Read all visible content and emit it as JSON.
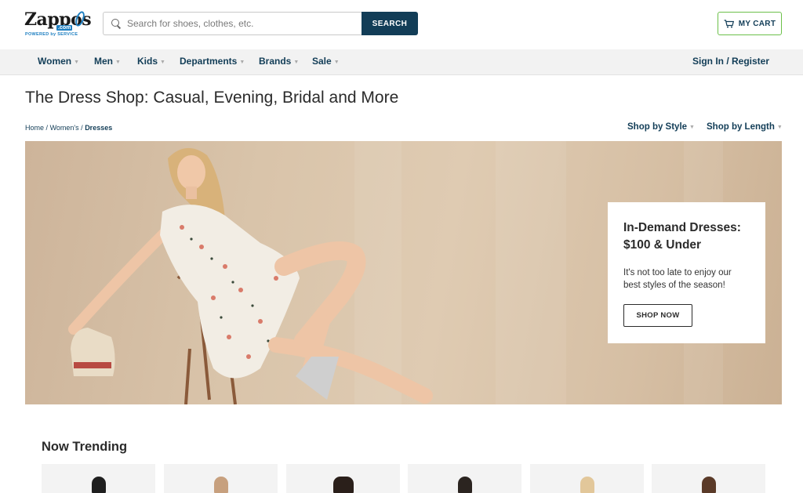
{
  "header": {
    "logo": {
      "name": "Zappos",
      "com": ".com",
      "tagline": "POWERED by SERVICE"
    },
    "search": {
      "placeholder": "Search for shoes, clothes, etc.",
      "button_label": "SEARCH"
    },
    "cart_label": "MY CART"
  },
  "nav": {
    "items": [
      {
        "label": "Women"
      },
      {
        "label": "Men"
      },
      {
        "label": "Kids"
      },
      {
        "label": "Departments"
      },
      {
        "label": "Brands"
      },
      {
        "label": "Sale"
      }
    ],
    "signin_label": "Sign In / Register"
  },
  "page": {
    "title": "The Dress Shop: Casual, Evening, Bridal and More",
    "breadcrumb": {
      "home": "Home",
      "womens": "Women's",
      "current": "Dresses",
      "separator": "/"
    },
    "shop_by_style": "Shop by Style",
    "shop_by_length": "Shop by Length"
  },
  "hero": {
    "promo_title_line1": "In-Demand Dresses:",
    "promo_title_line2": "$100 & Under",
    "promo_text": "It's not too late to enjoy our best styles of the season!",
    "promo_button": "SHOP NOW"
  },
  "trending": {
    "title": "Now Trending"
  },
  "colors": {
    "brand_navy": "#123d57",
    "cart_border": "#6cc04a",
    "logo_blue": "#1e7fc1",
    "hero_background": "#d9c4aa"
  }
}
